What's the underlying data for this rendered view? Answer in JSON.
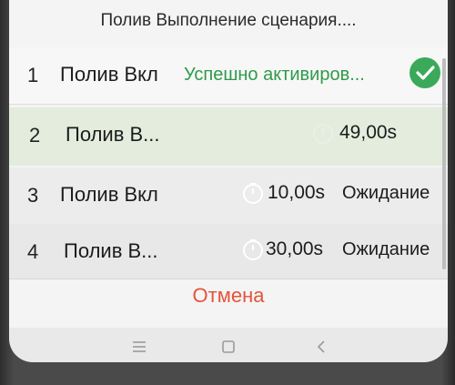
{
  "dialog": {
    "title": "Полив Выполнение сценария....",
    "cancel_label": "Отмена",
    "rows": [
      {
        "index": "1",
        "name": "Полив Вкл",
        "status": "Успешно активиров...",
        "timer": "",
        "waiting": ""
      },
      {
        "index": "2",
        "name": "Полив В...",
        "status": "",
        "timer": "49,00s",
        "waiting": ""
      },
      {
        "index": "3",
        "name": "Полив Вкл",
        "status": "",
        "timer": "10,00s",
        "waiting": "Ожидание"
      },
      {
        "index": "4",
        "name": "Полив В...",
        "status": "",
        "timer": "30,00s",
        "waiting": "Ожидание"
      }
    ]
  },
  "icons": {
    "success": "check-circle-icon",
    "clock": "clock-icon",
    "nav_menu": "menu-icon",
    "nav_home": "home-icon",
    "nav_back": "back-icon"
  },
  "colors": {
    "success": "#3aa95a",
    "cancel": "#e5533c",
    "row_active": "#e3ecdd"
  }
}
